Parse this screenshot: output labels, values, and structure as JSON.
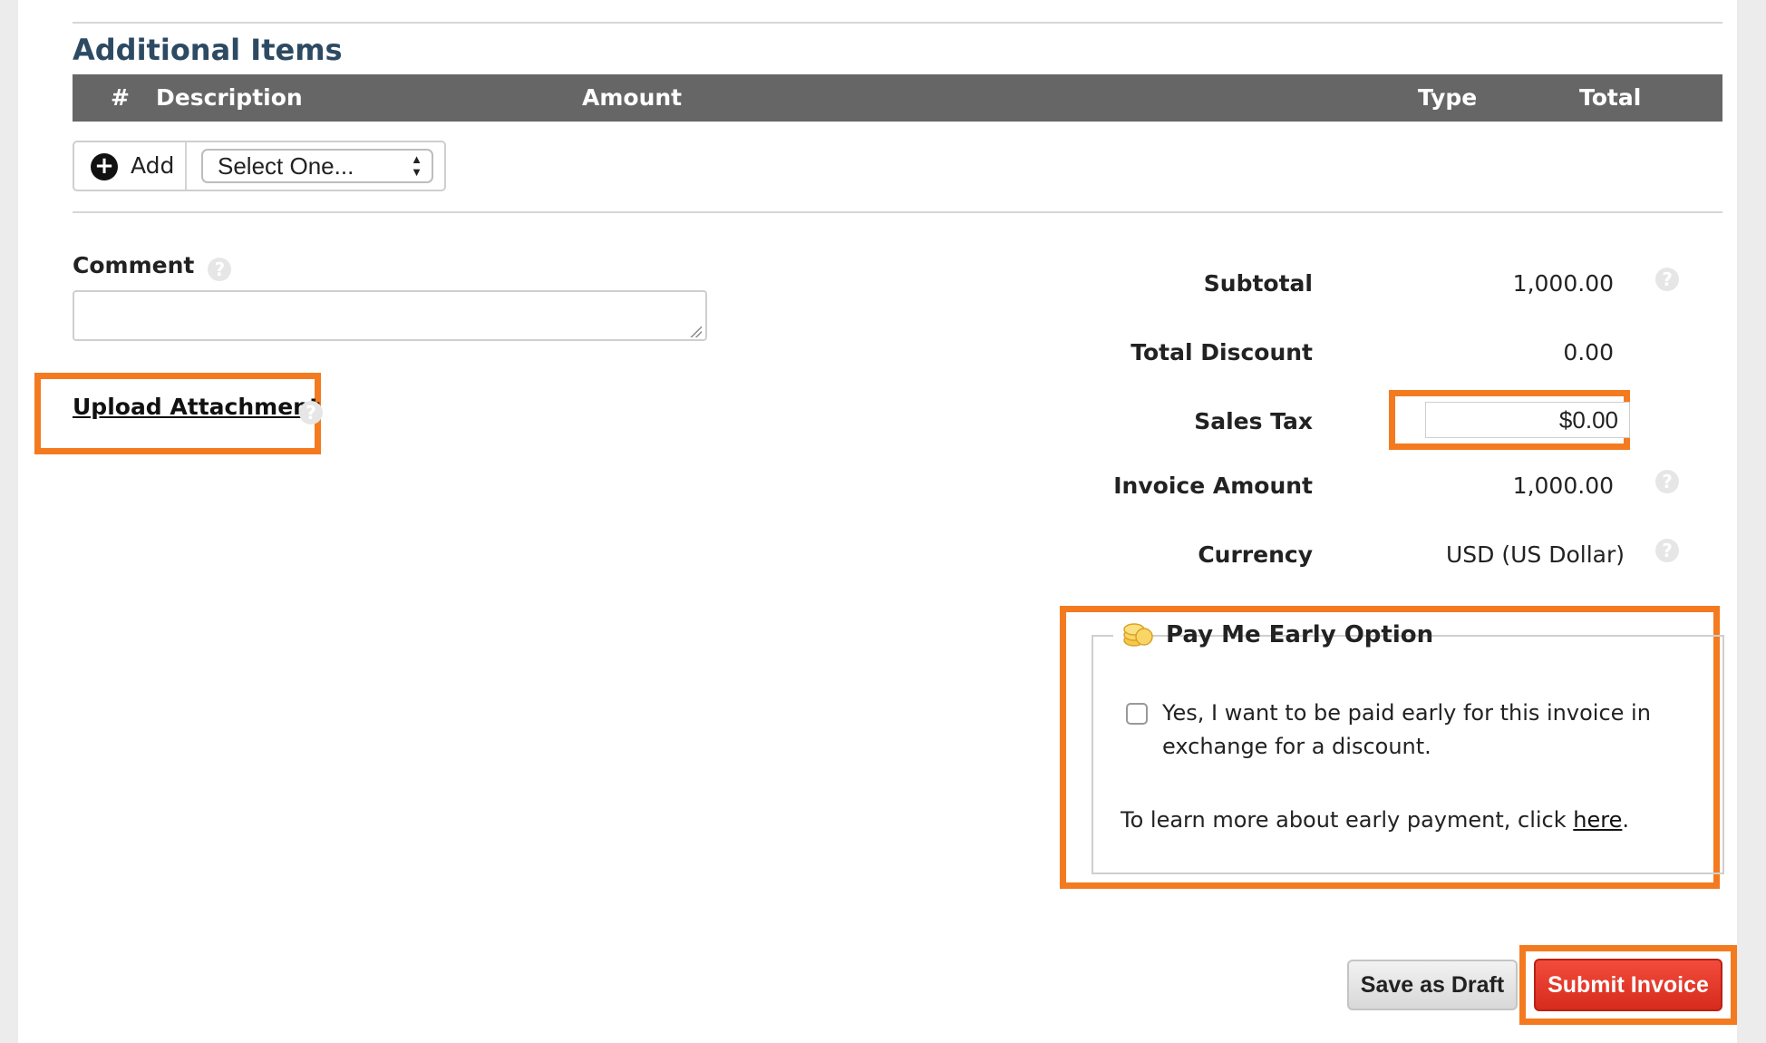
{
  "section": {
    "title": "Additional Items"
  },
  "table": {
    "headers": {
      "num": "#",
      "description": "Description",
      "amount": "Amount",
      "type": "Type",
      "total": "Total"
    }
  },
  "add_control": {
    "add_label": "Add",
    "select_value": "Select One..."
  },
  "comment": {
    "label": "Comment",
    "value": ""
  },
  "upload": {
    "label": "Upload Attachment"
  },
  "summary": {
    "subtotal_label": "Subtotal",
    "subtotal_value": "1,000.00",
    "discount_label": "Total Discount",
    "discount_value": "0.00",
    "tax_label": "Sales Tax",
    "tax_value": "$0.00",
    "invoice_label": "Invoice Amount",
    "invoice_value": "1,000.00",
    "currency_label": "Currency",
    "currency_value": "USD (US Dollar)"
  },
  "pay_early": {
    "title": "Pay Me Early Option",
    "checkbox_checked": false,
    "checkbox_label": "Yes, I want to be paid early for this invoice in exchange for a discount.",
    "learn_more_prefix": "To learn more about early payment, click ",
    "learn_more_link": "here",
    "learn_more_suffix": "."
  },
  "buttons": {
    "save_draft": "Save as Draft",
    "submit": "Submit Invoice"
  },
  "colors": {
    "accent_highlight": "#f47a20",
    "section_title": "#2d4a63",
    "table_header_bg": "#666666",
    "submit_bg": "#e3372a"
  },
  "icons": {
    "add": "plus-circle-icon",
    "help": "help-circle-icon",
    "pay_early": "coins-icon"
  }
}
